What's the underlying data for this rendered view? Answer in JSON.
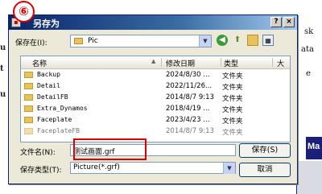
{
  "background": {
    "left_chars": [
      "u",
      "t",
      "u"
    ],
    "right_chars": [
      "sk",
      "ata",
      "e"
    ],
    "right_bar_text": "Ma"
  },
  "badge": {
    "text": "⑥"
  },
  "dialog": {
    "title": "另存为",
    "title_icon": "app-icon",
    "title_buttons": {
      "help": "?",
      "close": "×"
    },
    "save_in_label": "保存在(I):",
    "save_in_value": "Pic",
    "toolbar_icons": [
      "back-icon",
      "up-folder-icon",
      "new-folder-icon",
      "view-menu-icon"
    ],
    "columns": {
      "name": "名称",
      "date": "修改日期",
      "type": "类型",
      "size": "大"
    },
    "files": [
      {
        "name": "Backup",
        "date": "2024/8/30 ...",
        "type": "文件夹"
      },
      {
        "name": "Detail",
        "date": "2022/11/26...",
        "type": "文件夹"
      },
      {
        "name": "DetailFB",
        "date": "2014/8/7 9:13",
        "type": "文件夹"
      },
      {
        "name": "Extra_Dynamos",
        "date": "2018/4/19 ...",
        "type": "文件夹"
      },
      {
        "name": "Faceplate",
        "date": "2023/4/23 ...",
        "type": "文件夹"
      },
      {
        "name": "FaceplateFB",
        "date": "2014/8/7 9:13",
        "type": "文件夹"
      }
    ],
    "filename_label": "文件名(N):",
    "filename_value": "测试画面.grf",
    "filetype_label": "保存类型(T):",
    "filetype_value": "Picture(*.grf)",
    "save_button": "保存(S)",
    "cancel_button": "取消"
  }
}
